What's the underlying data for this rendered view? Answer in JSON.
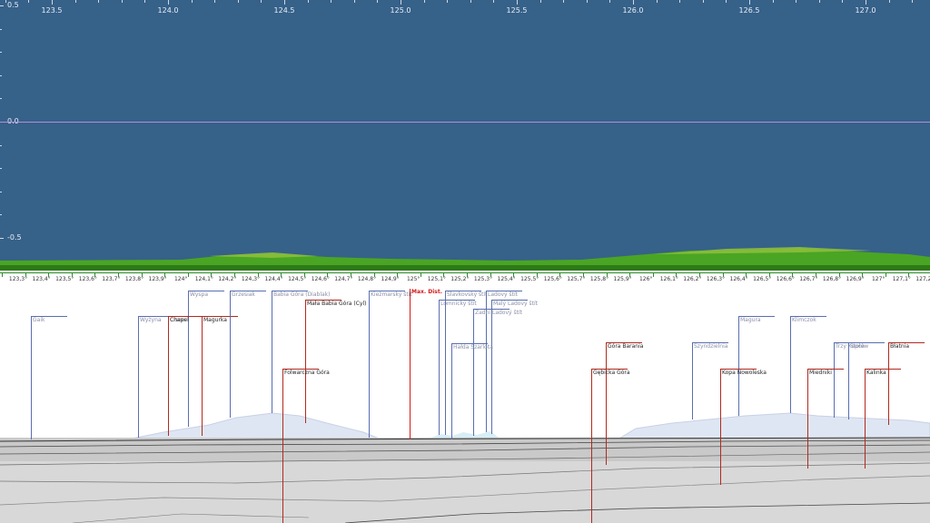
{
  "top_axis": {
    "labels": [
      "123.5",
      "124.0",
      "124.5",
      "125.0",
      "125.5",
      "126.0",
      "126.5",
      "127.0"
    ]
  },
  "left_axis": {
    "labels": [
      "0.5",
      "0.0",
      "-0.5"
    ],
    "values": [
      0.5,
      0.0,
      -0.5
    ]
  },
  "compass_axis": {
    "labels": [
      "123,3°",
      "123,4°",
      "123,5°",
      "123,6°",
      "123,7°",
      "123,8°",
      "123,9°",
      "124°",
      "124,1°",
      "124,2°",
      "124,3°",
      "124,4°",
      "124,5°",
      "124,6°",
      "124,7°",
      "124,8°",
      "124,9°",
      "125°",
      "125,1°",
      "125,2°",
      "125,3°",
      "125,4°",
      "125,5°",
      "125,6°",
      "125,7°",
      "125,8°",
      "125,9°",
      "126°",
      "126,1°",
      "126,2°",
      "126,3°",
      "126,4°",
      "126,5°",
      "126,6°",
      "126,7°",
      "126,8°",
      "126,9°",
      "127°",
      "127,1°",
      "127,2°"
    ]
  },
  "max_dist_label": "Max. Dist.",
  "colors": {
    "sky": "#366189",
    "horizon": "#b58bd9",
    "ridge_green": "#3f9e1f",
    "near_peak": "#b02a20",
    "far_peak": "#5a6eb0",
    "max_dist": "#d11a1a"
  },
  "peaks": [
    {
      "name": "Gaik",
      "kind": "far"
    },
    {
      "name": "Wyżyna",
      "kind": "far"
    },
    {
      "name": "Cisow",
      "kind": "far"
    },
    {
      "name": "Wyspa",
      "kind": "far"
    },
    {
      "name": "Chapel",
      "kind": "near"
    },
    {
      "name": "Magurka",
      "kind": "near"
    },
    {
      "name": "Grzesiak",
      "kind": "far"
    },
    {
      "name": "Babia Góra (Diablak)",
      "kind": "far"
    },
    {
      "name": "Mała Babia Góra (Cyl)",
      "kind": "near"
    },
    {
      "name": "Folwarczna Góra",
      "kind": "near"
    },
    {
      "name": "Kieżmarský štít",
      "kind": "far"
    },
    {
      "name": "Lomnický štít",
      "kind": "far"
    },
    {
      "name": "Slavkovský štít",
      "kind": "far"
    },
    {
      "name": "Ladový štít",
      "kind": "far"
    },
    {
      "name": "Malý Ladový štít",
      "kind": "far"
    },
    {
      "name": "Zadni Ladový štít",
      "kind": "far"
    },
    {
      "name": "Hałda Szarlota",
      "kind": "far"
    },
    {
      "name": "Góra Barania",
      "kind": "near"
    },
    {
      "name": "Gębicka Góra",
      "kind": "near"
    },
    {
      "name": "Szyndzielnia",
      "kind": "far"
    },
    {
      "name": "Magura",
      "kind": "far"
    },
    {
      "name": "Kopa Nowoleska",
      "kind": "near"
    },
    {
      "name": "Klimczok",
      "kind": "far"
    },
    {
      "name": "Trzy Kopce",
      "kind": "far"
    },
    {
      "name": "Stołów",
      "kind": "far"
    },
    {
      "name": "Błatnia",
      "kind": "near"
    },
    {
      "name": "Miedniki",
      "kind": "near"
    },
    {
      "name": "Kalinka",
      "kind": "near"
    }
  ]
}
